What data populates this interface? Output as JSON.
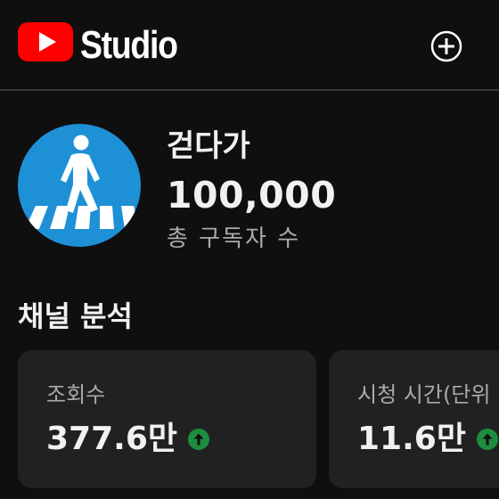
{
  "header": {
    "brand": "Studio",
    "create_icon": "add-circle-icon"
  },
  "channel": {
    "name": "걷다가",
    "subscriber_count": "100,000",
    "subscriber_label": "총 구독자 수",
    "avatar_icon": "pedestrian-crossing-icon",
    "avatar_color": "#1e90d6"
  },
  "analytics": {
    "title": "채널 분석",
    "cards": [
      {
        "label": "조회수",
        "value": "377.6만",
        "trend": "up",
        "trend_icon": "arrow-up-icon"
      },
      {
        "label": "시청 시간(단위",
        "value": "11.6만",
        "trend": "up",
        "trend_icon": "arrow-up-icon"
      }
    ]
  },
  "colors": {
    "background": "#0f0f0f",
    "card": "#212121",
    "brand_red": "#ff0000",
    "trend_green": "#1e8e3e",
    "secondary_text": "#aaaaaa"
  }
}
